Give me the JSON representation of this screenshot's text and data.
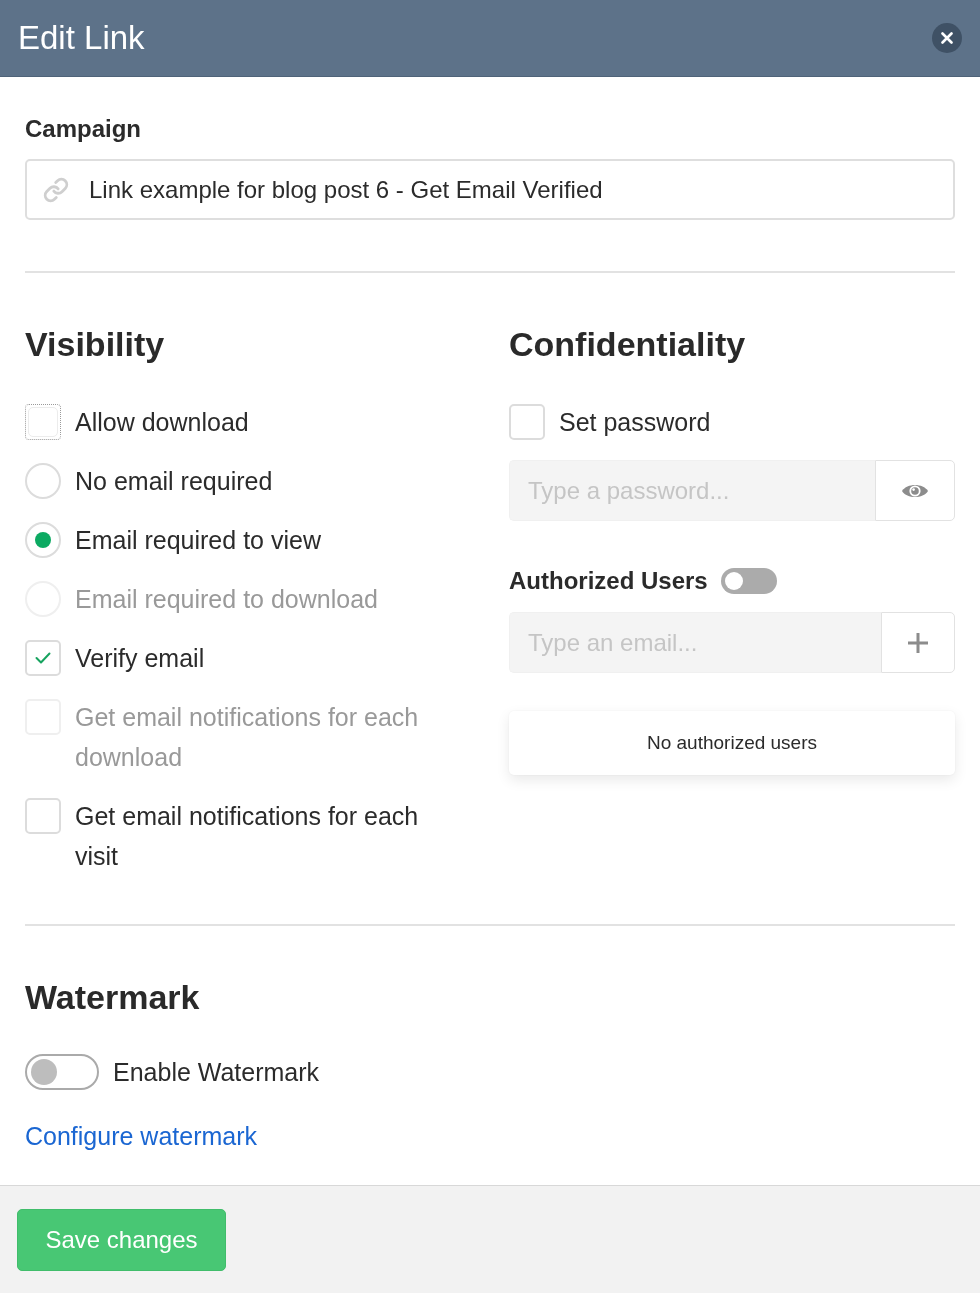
{
  "dialog": {
    "title": "Edit Link"
  },
  "campaign": {
    "label": "Campaign",
    "value": "Link example for blog post 6 - Get Email Verified"
  },
  "visibility": {
    "heading": "Visibility",
    "options": [
      {
        "kind": "checkbox",
        "label": "Allow download",
        "checked": false,
        "disabled": false,
        "focused": true
      },
      {
        "kind": "radio",
        "label": "No email required",
        "checked": false,
        "disabled": false,
        "focused": false
      },
      {
        "kind": "radio",
        "label": "Email required to view",
        "checked": true,
        "disabled": false,
        "focused": false
      },
      {
        "kind": "radio",
        "label": "Email required to download",
        "checked": false,
        "disabled": true,
        "focused": false
      },
      {
        "kind": "checkbox",
        "label": "Verify email",
        "checked": true,
        "disabled": false,
        "focused": false
      },
      {
        "kind": "checkbox",
        "label": "Get email notifications for each download",
        "checked": false,
        "disabled": true,
        "focused": false
      },
      {
        "kind": "checkbox",
        "label": "Get email notifications for each visit",
        "checked": false,
        "disabled": false,
        "focused": false
      }
    ]
  },
  "confidentiality": {
    "heading": "Confidentiality",
    "set_password": {
      "kind": "checkbox",
      "label": "Set password",
      "checked": false
    },
    "password": {
      "placeholder": "Type a password..."
    },
    "authorized_users": {
      "label": "Authorized Users",
      "on": false,
      "email": {
        "placeholder": "Type an email..."
      },
      "empty_message": "No authorized users"
    }
  },
  "watermark": {
    "heading": "Watermark",
    "enable": {
      "label": "Enable Watermark",
      "on": false
    },
    "configure_link": "Configure watermark"
  },
  "footer": {
    "save_button": "Save changes"
  }
}
